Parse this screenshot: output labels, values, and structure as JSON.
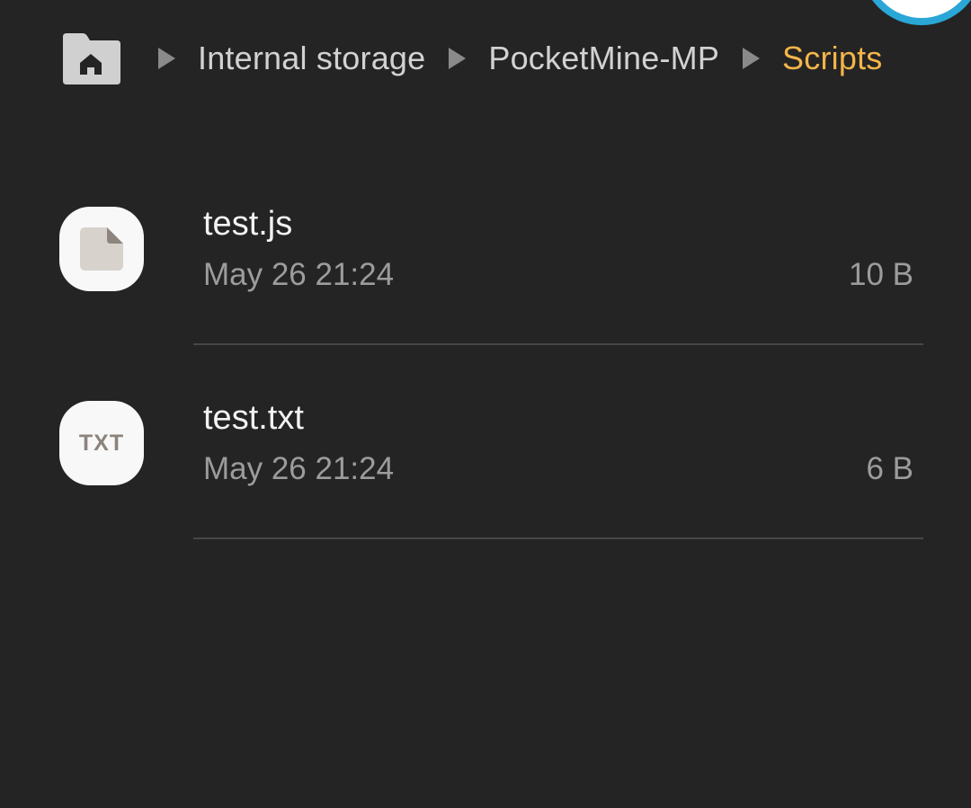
{
  "breadcrumb": {
    "home_icon": "home-folder-icon",
    "separator_icon": "chevron-right-icon",
    "items": [
      {
        "label": "Internal storage"
      },
      {
        "label": "PocketMine-MP"
      },
      {
        "label": "Scripts"
      }
    ]
  },
  "files": [
    {
      "name": "test.js",
      "date": "May 26 21:24",
      "size": "10 B",
      "icon": "document-file-icon"
    },
    {
      "name": "test.txt",
      "date": "May 26 21:24",
      "size": "6 B",
      "icon": "txt-file-icon",
      "icon_text": "TXT"
    }
  ],
  "colors": {
    "background": "#242424",
    "current_crumb": "#f4b54a",
    "text_primary": "#f2f2f2",
    "text_secondary": "#9c9c9c",
    "divider": "#474747"
  },
  "corner_badge_icon": "app-badge-icon"
}
